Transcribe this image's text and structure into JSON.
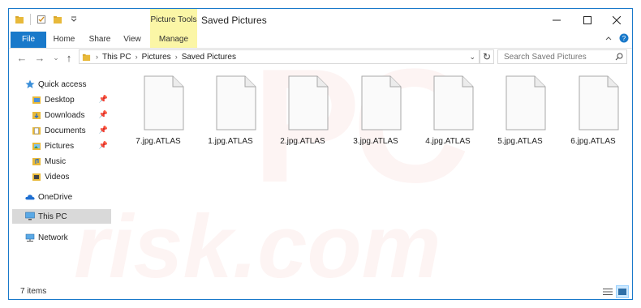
{
  "window": {
    "title": "Saved Pictures",
    "context_tab_group": "Picture Tools"
  },
  "ribbon": {
    "tabs": [
      {
        "label": "File"
      },
      {
        "label": "Home"
      },
      {
        "label": "Share"
      },
      {
        "label": "View"
      },
      {
        "label": "Manage"
      }
    ]
  },
  "address": {
    "breadcrumbs": [
      "This PC",
      "Pictures",
      "Saved Pictures"
    ]
  },
  "search": {
    "placeholder": "Search Saved Pictures"
  },
  "sidebar": {
    "items": [
      {
        "label": "Quick access",
        "icon": "star-icon"
      },
      {
        "label": "Desktop",
        "icon": "desktop-folder-icon",
        "pinned": true
      },
      {
        "label": "Downloads",
        "icon": "downloads-folder-icon",
        "pinned": true
      },
      {
        "label": "Documents",
        "icon": "documents-folder-icon",
        "pinned": true
      },
      {
        "label": "Pictures",
        "icon": "pictures-folder-icon",
        "pinned": true
      },
      {
        "label": "Music",
        "icon": "music-folder-icon"
      },
      {
        "label": "Videos",
        "icon": "videos-folder-icon"
      },
      {
        "label": "OneDrive",
        "icon": "cloud-icon"
      },
      {
        "label": "This PC",
        "icon": "computer-icon",
        "selected": true
      },
      {
        "label": "Network",
        "icon": "network-icon"
      }
    ]
  },
  "files": [
    {
      "name": "7.jpg.ATLAS"
    },
    {
      "name": "1.jpg.ATLAS"
    },
    {
      "name": "2.jpg.ATLAS"
    },
    {
      "name": "3.jpg.ATLAS"
    },
    {
      "name": "4.jpg.ATLAS"
    },
    {
      "name": "5.jpg.ATLAS"
    },
    {
      "name": "6.jpg.ATLAS"
    }
  ],
  "status": {
    "item_count": "7 items"
  },
  "watermark": {
    "text_top": "PC",
    "text_bottom": "risk.com"
  },
  "colors": {
    "accent": "#1979ca",
    "context_tab": "#fbf6a6",
    "selected_nav": "#d9d9d9"
  }
}
